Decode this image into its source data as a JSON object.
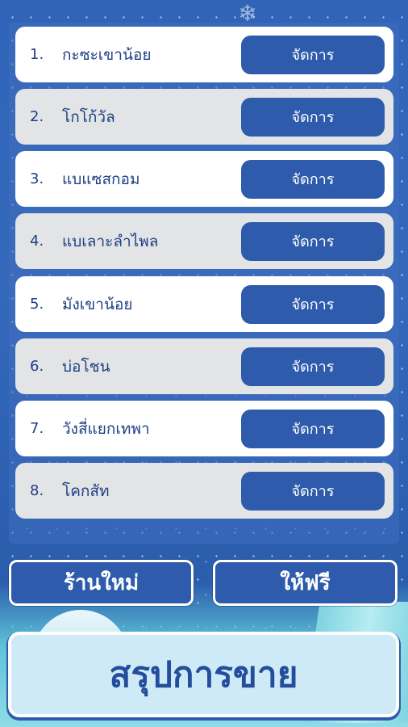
{
  "stores": [
    {
      "number": "1.",
      "name": "กะซะเขาน้อย",
      "action": "จัดการ"
    },
    {
      "number": "2.",
      "name": "โกโก้วัล",
      "action": "จัดการ"
    },
    {
      "number": "3.",
      "name": "แบแซสกอม",
      "action": "จัดการ"
    },
    {
      "number": "4.",
      "name": "แบเลาะลำไพล",
      "action": "จัดการ"
    },
    {
      "number": "5.",
      "name": "มังเขาน้อย",
      "action": "จัดการ"
    },
    {
      "number": "6.",
      "name": "บ่อโชน",
      "action": "จัดการ"
    },
    {
      "number": "7.",
      "name": "วังสี่แยกเทพา",
      "action": "จัดการ"
    },
    {
      "number": "8.",
      "name": "โคกสัท",
      "action": "จัดการ"
    }
  ],
  "buttons": {
    "new_store": "ร้านใหม่",
    "give_free": "ให้ฟรี",
    "sales_summary": "สรุปการขาย"
  },
  "colors": {
    "background": "#3468bb",
    "button": "#2e5bab",
    "text": "#1e3f86",
    "summary_bg": "#cfeaf7"
  },
  "icons": {
    "decoration": "snowflake-icon"
  }
}
